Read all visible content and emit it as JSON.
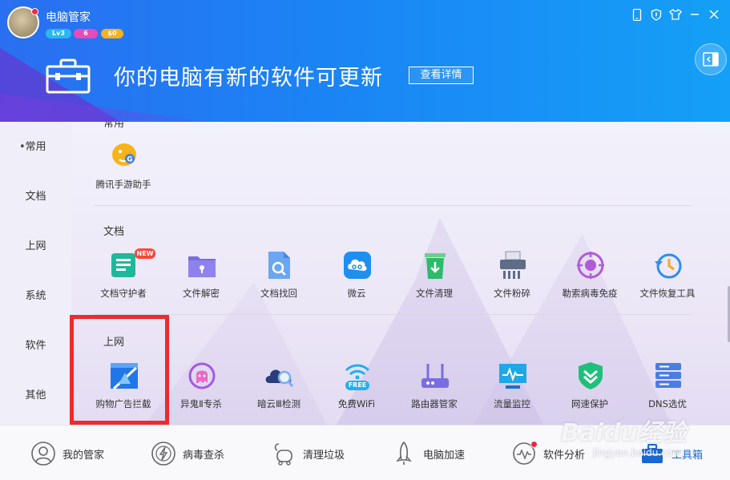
{
  "header": {
    "title": "电脑管家",
    "badges": [
      "Lv3",
      "6",
      "$0"
    ],
    "banner_text": "你的电脑有新的软件可更新",
    "banner_button": "查看详情",
    "window_buttons": [
      "phone-icon",
      "shield-icon",
      "shirt-icon",
      "minimize-icon",
      "close-icon"
    ],
    "accent": "#1b84f5"
  },
  "sidebar": {
    "items": [
      {
        "label": "常用",
        "active": true
      },
      {
        "label": "文档"
      },
      {
        "label": "上网"
      },
      {
        "label": "系统"
      },
      {
        "label": "软件"
      },
      {
        "label": "其他"
      }
    ]
  },
  "sections": {
    "common": {
      "title": "常用",
      "tiles": [
        {
          "label": "腾讯手游助手",
          "icon": "game-assistant-icon"
        }
      ]
    },
    "docs": {
      "title": "文档",
      "tiles": [
        {
          "label": "文档守护者",
          "icon": "doc-guard-icon",
          "badge": "NEW"
        },
        {
          "label": "文件解密",
          "icon": "folder-lock-icon"
        },
        {
          "label": "文档找回",
          "icon": "doc-search-icon"
        },
        {
          "label": "微云",
          "icon": "weiyun-icon"
        },
        {
          "label": "文件清理",
          "icon": "trash-icon"
        },
        {
          "label": "文件粉碎",
          "icon": "shredder-icon"
        },
        {
          "label": "勒索病毒免疫",
          "icon": "virus-immune-icon"
        },
        {
          "label": "文件恢复工具",
          "icon": "restore-clock-icon"
        }
      ]
    },
    "internet": {
      "title": "上网",
      "tiles": [
        {
          "label": "购物广告拦截",
          "icon": "ad-block-icon"
        },
        {
          "label": "异鬼Ⅱ专杀",
          "icon": "ghost-icon"
        },
        {
          "label": "暗云Ⅲ检测",
          "icon": "cloud-scan-icon"
        },
        {
          "label": "免费WiFi",
          "icon": "wifi-free-icon",
          "badge": "FREE"
        },
        {
          "label": "路由器管家",
          "icon": "router-icon"
        },
        {
          "label": "流量监控",
          "icon": "monitor-icon"
        },
        {
          "label": "网速保护",
          "icon": "speed-shield-icon"
        },
        {
          "label": "DNS选优",
          "icon": "dns-server-icon"
        }
      ]
    }
  },
  "bottom_nav": {
    "items": [
      {
        "label": "我的管家",
        "icon": "person-icon"
      },
      {
        "label": "病毒查杀",
        "icon": "lightning-icon"
      },
      {
        "label": "清理垃圾",
        "icon": "vacuum-icon"
      },
      {
        "label": "电脑加速",
        "icon": "rocket-icon"
      },
      {
        "label": "软件分析",
        "icon": "gauge-icon"
      },
      {
        "label": "工具箱",
        "icon": "toolbox-icon",
        "active": true
      }
    ]
  },
  "watermark": {
    "text": "Baidu经验",
    "url": "jingyan.baidu.com"
  }
}
